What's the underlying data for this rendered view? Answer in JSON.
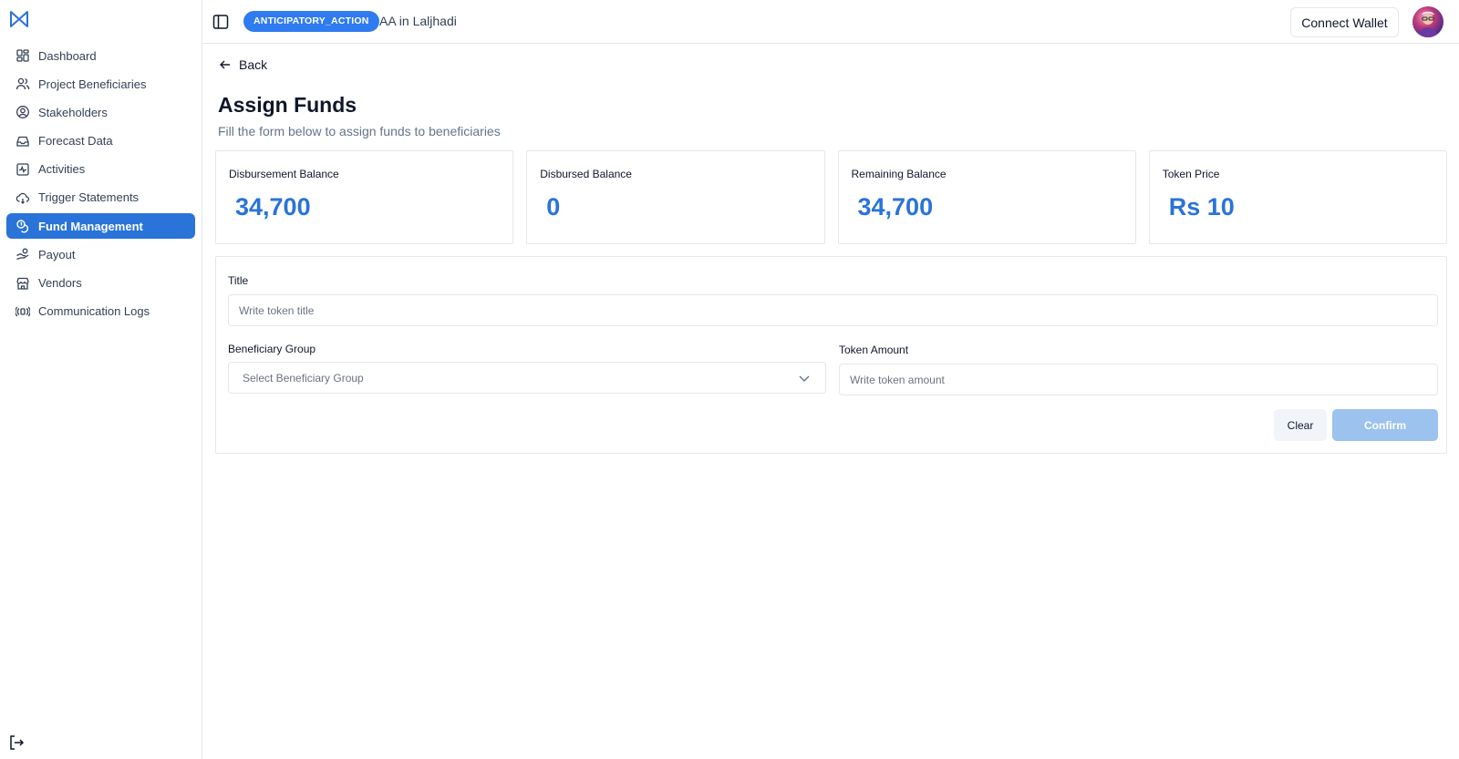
{
  "sidebar": {
    "logo_icon": "rahat-logo-icon",
    "items": [
      {
        "label": "Dashboard",
        "icon": "dashboard-icon"
      },
      {
        "label": "Project Beneficiaries",
        "icon": "users-icon"
      },
      {
        "label": "Stakeholders",
        "icon": "user-circle-icon"
      },
      {
        "label": "Forecast Data",
        "icon": "inbox-icon"
      },
      {
        "label": "Activities",
        "icon": "activity-icon"
      },
      {
        "label": "Trigger Statements",
        "icon": "cloud-icon"
      },
      {
        "label": "Fund Management",
        "icon": "coins-icon",
        "active": true
      },
      {
        "label": "Payout",
        "icon": "payout-icon"
      },
      {
        "label": "Vendors",
        "icon": "store-icon"
      },
      {
        "label": "Communication Logs",
        "icon": "broadcast-icon"
      }
    ],
    "logout_icon": "logout-icon"
  },
  "header": {
    "project_badge": "ANTICIPATORY_ACTION",
    "project_name": "AA in Laljhadi",
    "connect_wallet": "Connect Wallet"
  },
  "page": {
    "back_label": "Back",
    "title": "Assign Funds",
    "subtitle": "Fill the form below to assign funds to beneficiaries"
  },
  "cards": [
    {
      "label": "Disbursement Balance",
      "value": "34,700"
    },
    {
      "label": "Disbursed Balance",
      "value": "0"
    },
    {
      "label": "Remaining Balance",
      "value": "34,700"
    },
    {
      "label": "Token Price",
      "value": "Rs 10"
    }
  ],
  "form": {
    "title_label": "Title",
    "title_placeholder": "Write token title",
    "group_label": "Beneficiary Group",
    "group_placeholder": "Select Beneficiary Group",
    "amount_label": "Token Amount",
    "amount_placeholder": "Write token amount",
    "clear_label": "Clear",
    "confirm_label": "Confirm"
  },
  "colors": {
    "accent": "#2a73d9",
    "badge": "#2f7bf0",
    "confirm_disabled": "#9cc2ee"
  }
}
